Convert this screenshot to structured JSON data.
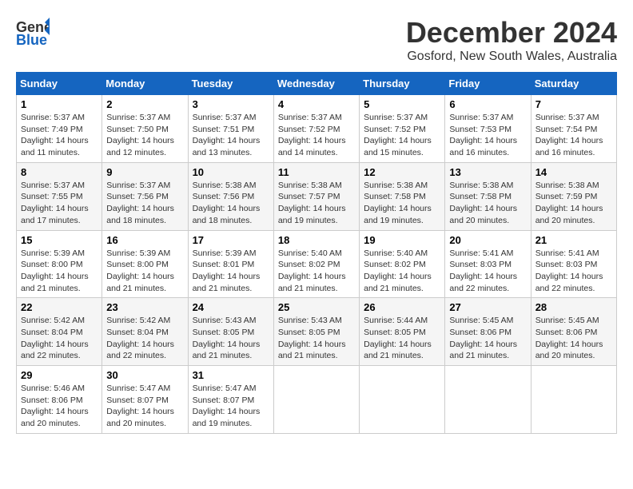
{
  "logo": {
    "general": "General",
    "blue": "Blue"
  },
  "header": {
    "month": "December 2024",
    "location": "Gosford, New South Wales, Australia"
  },
  "weekdays": [
    "Sunday",
    "Monday",
    "Tuesday",
    "Wednesday",
    "Thursday",
    "Friday",
    "Saturday"
  ],
  "weeks": [
    [
      {
        "day": "1",
        "sunrise": "5:37 AM",
        "sunset": "7:49 PM",
        "daylight": "14 hours and 11 minutes."
      },
      {
        "day": "2",
        "sunrise": "5:37 AM",
        "sunset": "7:50 PM",
        "daylight": "14 hours and 12 minutes."
      },
      {
        "day": "3",
        "sunrise": "5:37 AM",
        "sunset": "7:51 PM",
        "daylight": "14 hours and 13 minutes."
      },
      {
        "day": "4",
        "sunrise": "5:37 AM",
        "sunset": "7:52 PM",
        "daylight": "14 hours and 14 minutes."
      },
      {
        "day": "5",
        "sunrise": "5:37 AM",
        "sunset": "7:52 PM",
        "daylight": "14 hours and 15 minutes."
      },
      {
        "day": "6",
        "sunrise": "5:37 AM",
        "sunset": "7:53 PM",
        "daylight": "14 hours and 16 minutes."
      },
      {
        "day": "7",
        "sunrise": "5:37 AM",
        "sunset": "7:54 PM",
        "daylight": "14 hours and 16 minutes."
      }
    ],
    [
      {
        "day": "8",
        "sunrise": "5:37 AM",
        "sunset": "7:55 PM",
        "daylight": "14 hours and 17 minutes."
      },
      {
        "day": "9",
        "sunrise": "5:37 AM",
        "sunset": "7:56 PM",
        "daylight": "14 hours and 18 minutes."
      },
      {
        "day": "10",
        "sunrise": "5:38 AM",
        "sunset": "7:56 PM",
        "daylight": "14 hours and 18 minutes."
      },
      {
        "day": "11",
        "sunrise": "5:38 AM",
        "sunset": "7:57 PM",
        "daylight": "14 hours and 19 minutes."
      },
      {
        "day": "12",
        "sunrise": "5:38 AM",
        "sunset": "7:58 PM",
        "daylight": "14 hours and 19 minutes."
      },
      {
        "day": "13",
        "sunrise": "5:38 AM",
        "sunset": "7:58 PM",
        "daylight": "14 hours and 20 minutes."
      },
      {
        "day": "14",
        "sunrise": "5:38 AM",
        "sunset": "7:59 PM",
        "daylight": "14 hours and 20 minutes."
      }
    ],
    [
      {
        "day": "15",
        "sunrise": "5:39 AM",
        "sunset": "8:00 PM",
        "daylight": "14 hours and 21 minutes."
      },
      {
        "day": "16",
        "sunrise": "5:39 AM",
        "sunset": "8:00 PM",
        "daylight": "14 hours and 21 minutes."
      },
      {
        "day": "17",
        "sunrise": "5:39 AM",
        "sunset": "8:01 PM",
        "daylight": "14 hours and 21 minutes."
      },
      {
        "day": "18",
        "sunrise": "5:40 AM",
        "sunset": "8:02 PM",
        "daylight": "14 hours and 21 minutes."
      },
      {
        "day": "19",
        "sunrise": "5:40 AM",
        "sunset": "8:02 PM",
        "daylight": "14 hours and 21 minutes."
      },
      {
        "day": "20",
        "sunrise": "5:41 AM",
        "sunset": "8:03 PM",
        "daylight": "14 hours and 22 minutes."
      },
      {
        "day": "21",
        "sunrise": "5:41 AM",
        "sunset": "8:03 PM",
        "daylight": "14 hours and 22 minutes."
      }
    ],
    [
      {
        "day": "22",
        "sunrise": "5:42 AM",
        "sunset": "8:04 PM",
        "daylight": "14 hours and 22 minutes."
      },
      {
        "day": "23",
        "sunrise": "5:42 AM",
        "sunset": "8:04 PM",
        "daylight": "14 hours and 22 minutes."
      },
      {
        "day": "24",
        "sunrise": "5:43 AM",
        "sunset": "8:05 PM",
        "daylight": "14 hours and 21 minutes."
      },
      {
        "day": "25",
        "sunrise": "5:43 AM",
        "sunset": "8:05 PM",
        "daylight": "14 hours and 21 minutes."
      },
      {
        "day": "26",
        "sunrise": "5:44 AM",
        "sunset": "8:05 PM",
        "daylight": "14 hours and 21 minutes."
      },
      {
        "day": "27",
        "sunrise": "5:45 AM",
        "sunset": "8:06 PM",
        "daylight": "14 hours and 21 minutes."
      },
      {
        "day": "28",
        "sunrise": "5:45 AM",
        "sunset": "8:06 PM",
        "daylight": "14 hours and 20 minutes."
      }
    ],
    [
      {
        "day": "29",
        "sunrise": "5:46 AM",
        "sunset": "8:06 PM",
        "daylight": "14 hours and 20 minutes."
      },
      {
        "day": "30",
        "sunrise": "5:47 AM",
        "sunset": "8:07 PM",
        "daylight": "14 hours and 20 minutes."
      },
      {
        "day": "31",
        "sunrise": "5:47 AM",
        "sunset": "8:07 PM",
        "daylight": "14 hours and 19 minutes."
      },
      null,
      null,
      null,
      null
    ]
  ],
  "labels": {
    "sunrise": "Sunrise:",
    "sunset": "Sunset:",
    "daylight": "Daylight:"
  }
}
